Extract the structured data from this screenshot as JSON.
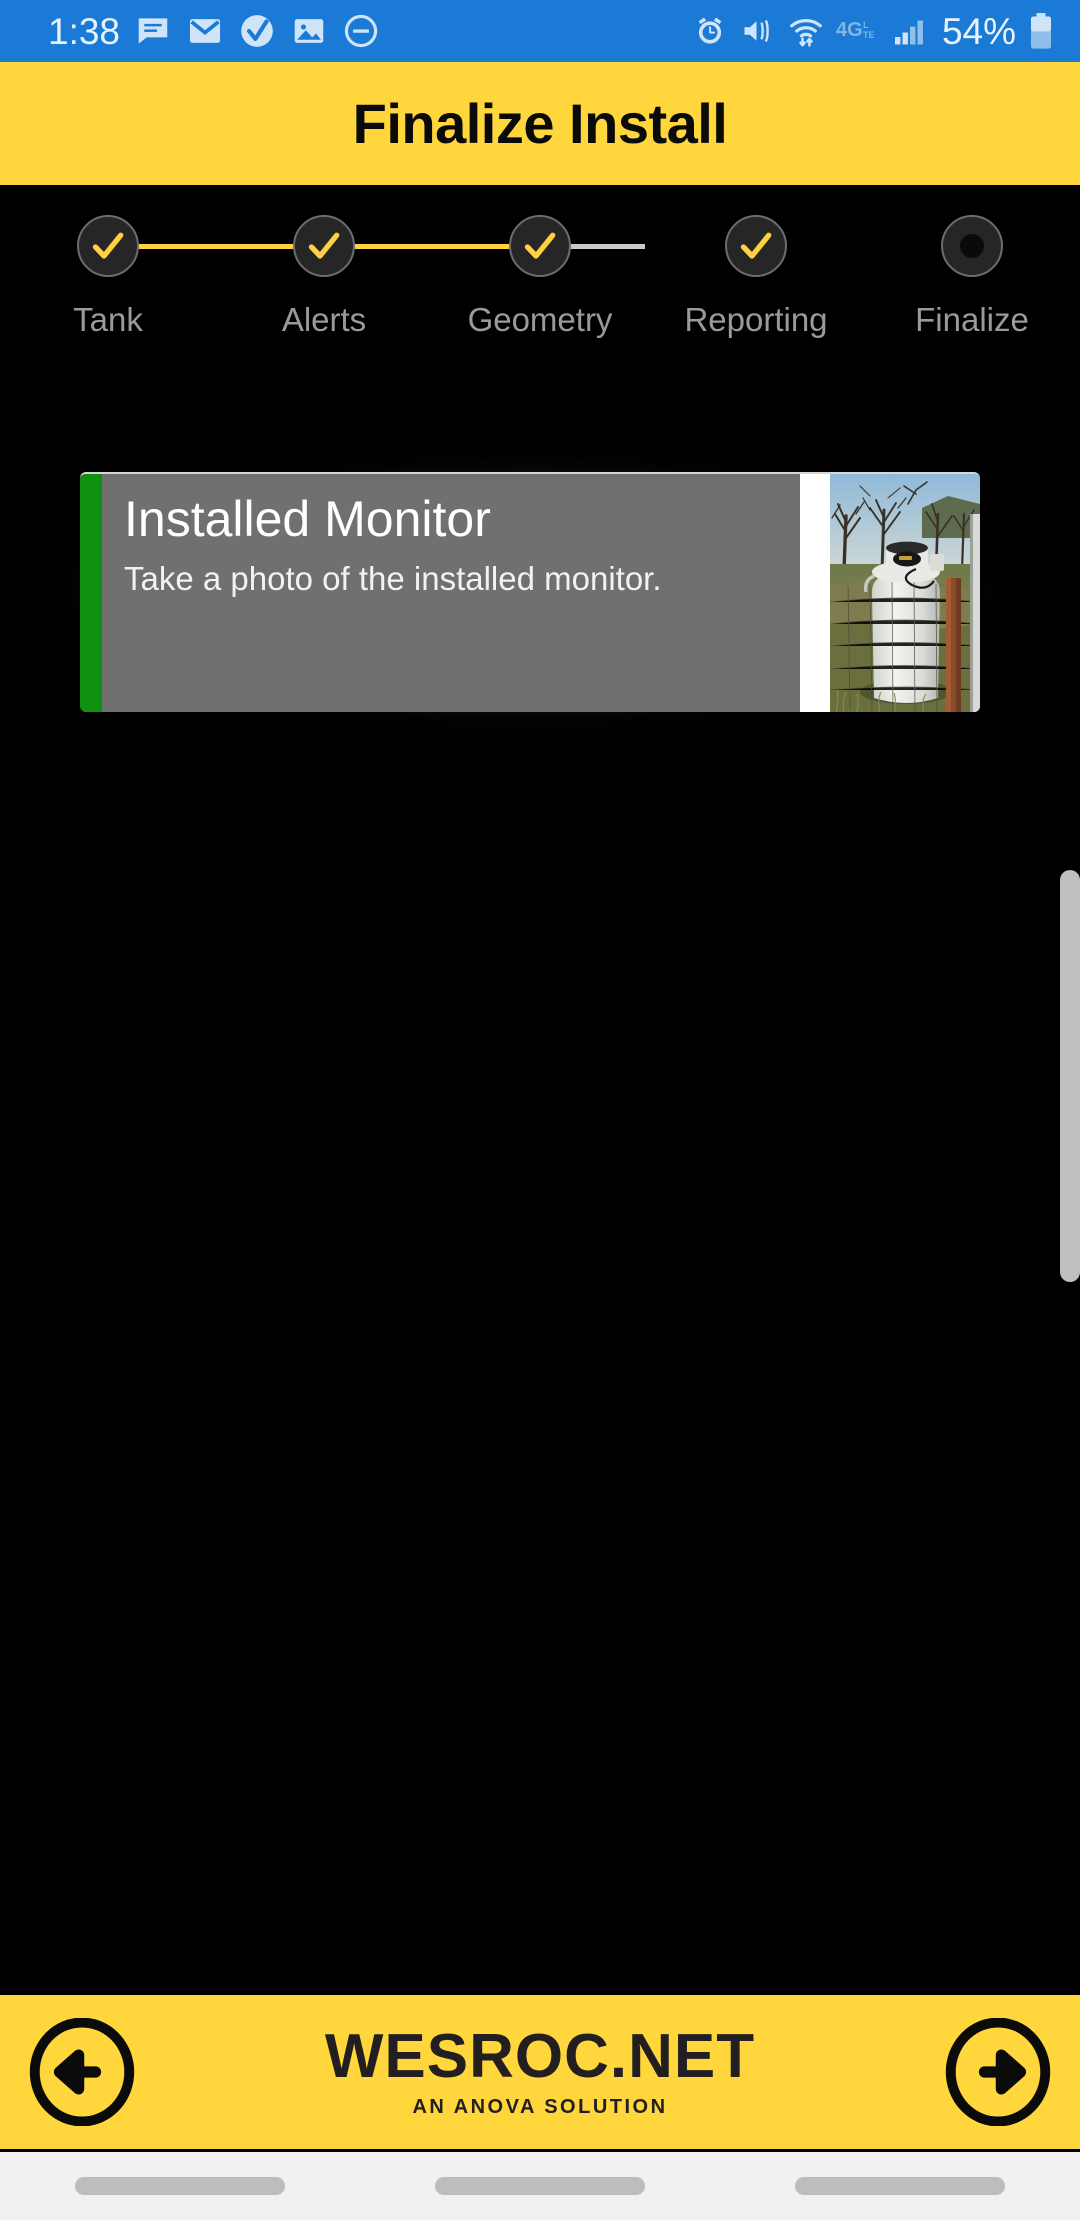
{
  "status_bar": {
    "time": "1:38",
    "battery_percent": "54%",
    "left_icons": [
      "message-icon",
      "email-icon",
      "checkmark-badge-icon",
      "photo-icon",
      "do-not-disturb-icon"
    ],
    "right_icons": [
      "alarm-icon",
      "mute-vibrate-icon",
      "wifi-icon",
      "lte-4g-icon",
      "signal-bars-icon",
      "battery-icon"
    ],
    "background_color": "#1b7ad6",
    "text_color": "#e8f2fc"
  },
  "header": {
    "title": "Finalize Install",
    "background_color": "#ffd63b",
    "text_color": "#0a0a0a"
  },
  "stepper": {
    "active_color": "#ffd040",
    "inactive_color": "#c9c9c9",
    "steps": [
      {
        "label": "Tank",
        "state": "complete",
        "icon": "check-icon"
      },
      {
        "label": "Alerts",
        "state": "complete",
        "icon": "check-icon"
      },
      {
        "label": "Geometry",
        "state": "complete",
        "icon": "check-icon"
      },
      {
        "label": "Reporting",
        "state": "complete",
        "icon": "check-icon"
      },
      {
        "label": "Finalize",
        "state": "current",
        "icon": "dot-icon"
      }
    ]
  },
  "card": {
    "title": "Installed Monitor",
    "subtitle": "Take a photo of the installed monitor.",
    "accent_color": "#0f9010",
    "background_color": "#707070",
    "thumbnail_alt": "photo of propane tank with installed monitor",
    "thumbnail_name": "installed-monitor-thumbnail"
  },
  "scrollbar": {
    "name": "vertical-scrollbar",
    "thumb_color": "#c0c0c0"
  },
  "bottom_bar": {
    "brand_name": "WESROC.NET",
    "brand_tagline": "AN ANOVA SOLUTION",
    "background_color": "#ffd63b",
    "back_label": "back-arrow-icon",
    "forward_label": "forward-arrow-icon"
  },
  "android_nav": {
    "pill_count": 3
  }
}
